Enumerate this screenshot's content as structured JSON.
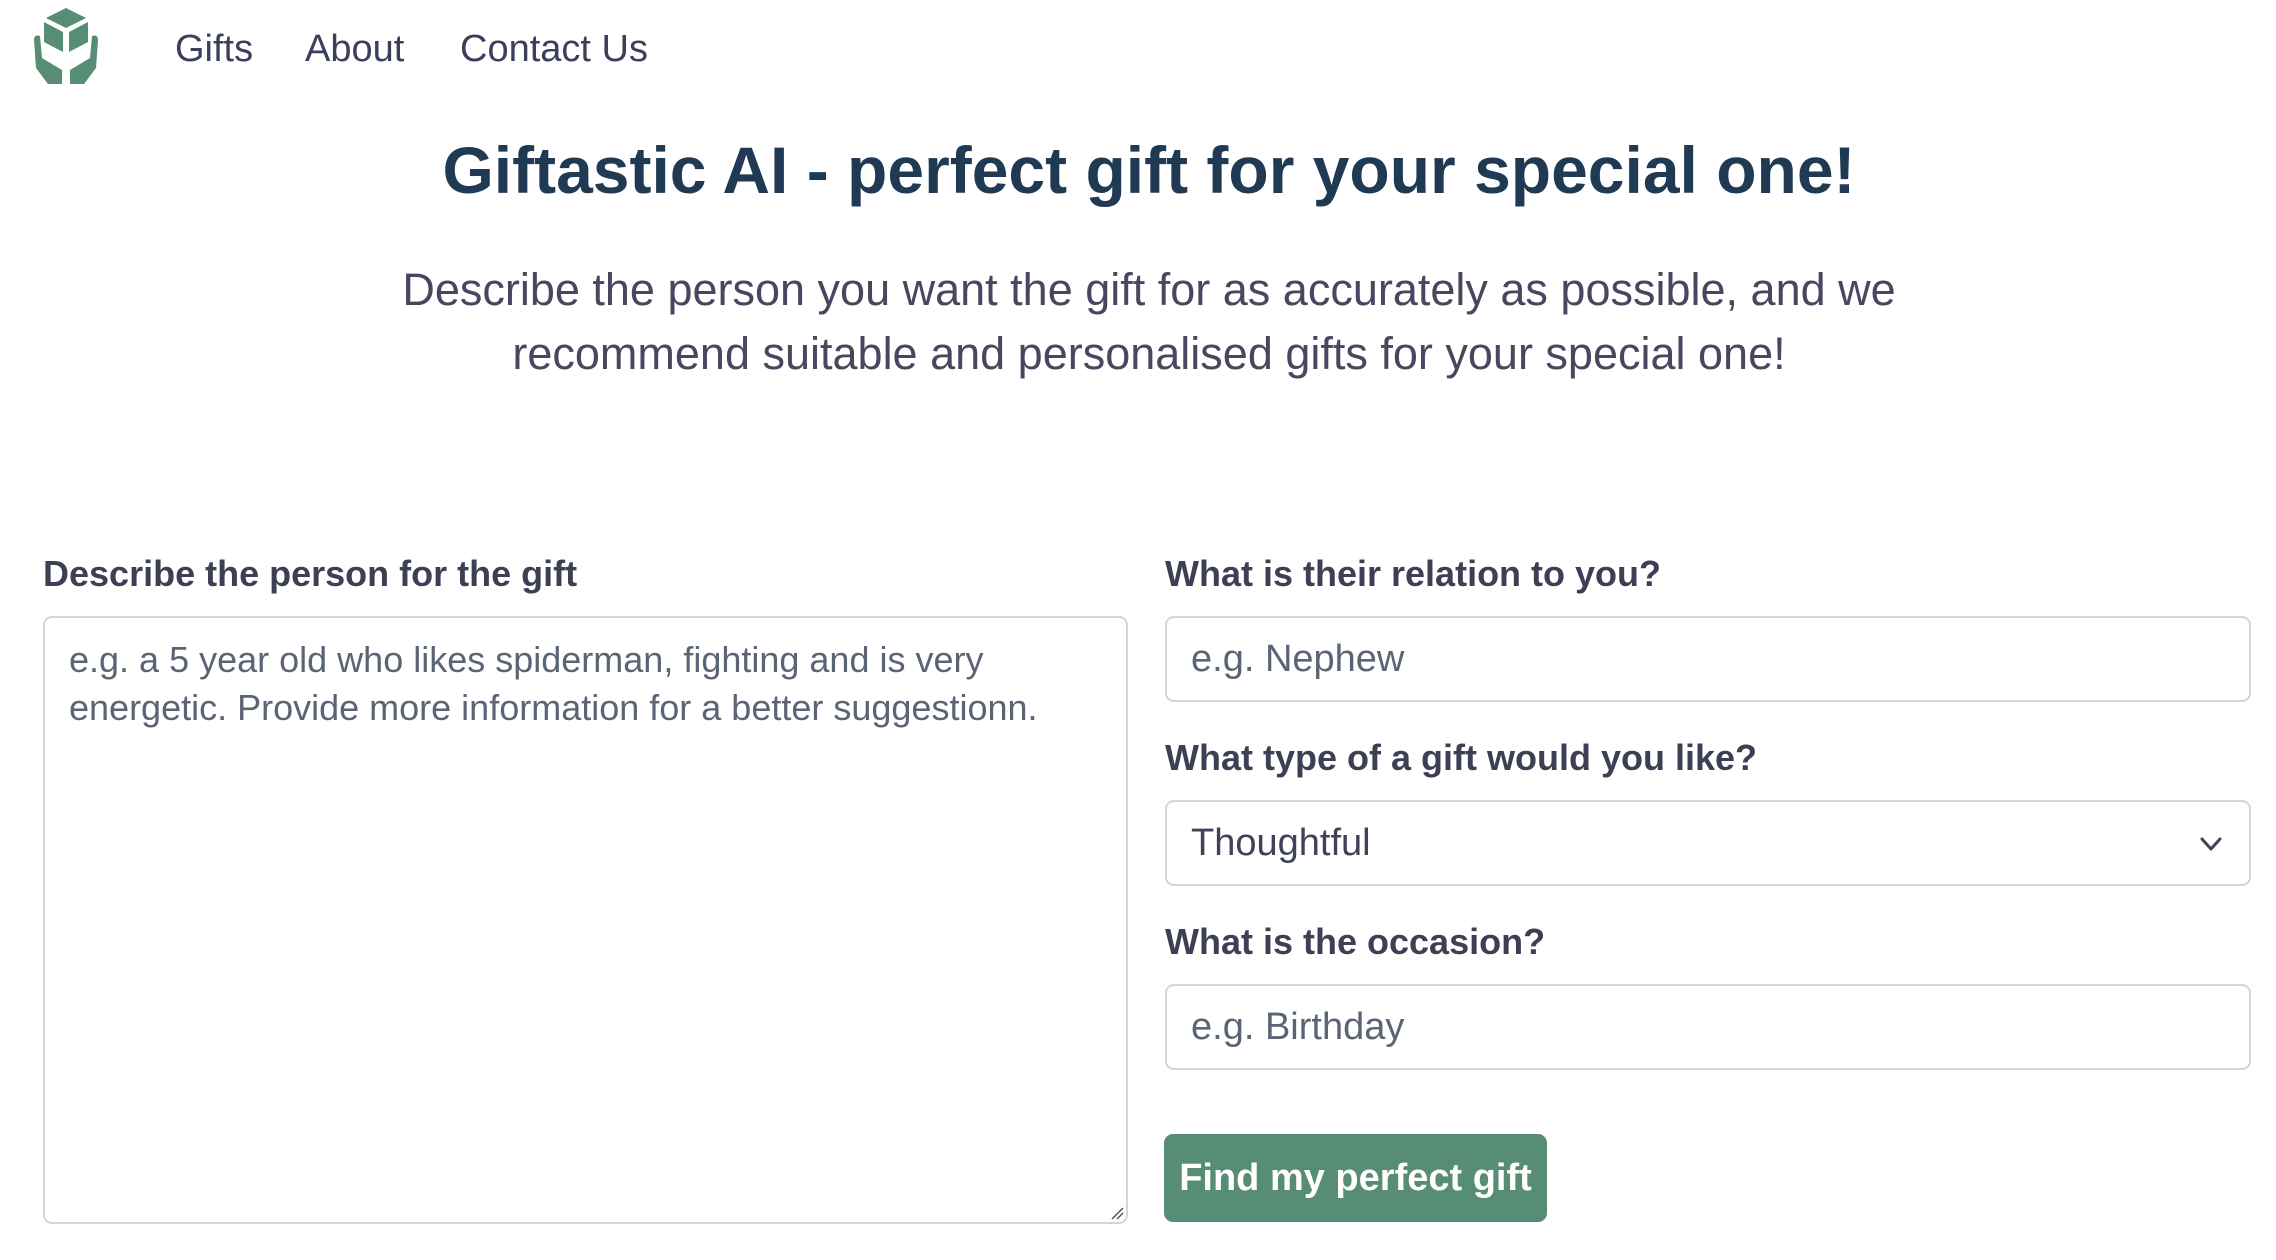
{
  "nav": {
    "logo_icon": "hands-holding-box-icon",
    "links": [
      "Gifts",
      "About",
      "Contact Us"
    ]
  },
  "hero": {
    "title": "Giftastic AI - perfect gift for your special one!",
    "subtitle": "Describe the person you want the gift for as accurately as possible, and we recommend suitable and personalised gifts for your special one!"
  },
  "form": {
    "description": {
      "label": "Describe the person for the gift",
      "placeholder": "e.g. a 5 year old who likes spiderman, fighting and is very energetic. Provide more information for a better suggestionn."
    },
    "relation": {
      "label": "What is their relation to you?",
      "placeholder": "e.g. Nephew"
    },
    "gift_type": {
      "label": "What type of a gift would you like?",
      "selected": "Thoughtful"
    },
    "occasion": {
      "label": "What is the occasion?",
      "placeholder": "e.g. Birthday"
    },
    "submit_label": "Find my perfect gift"
  },
  "colors": {
    "brand": "#578c75",
    "heading": "#1f3a52"
  }
}
